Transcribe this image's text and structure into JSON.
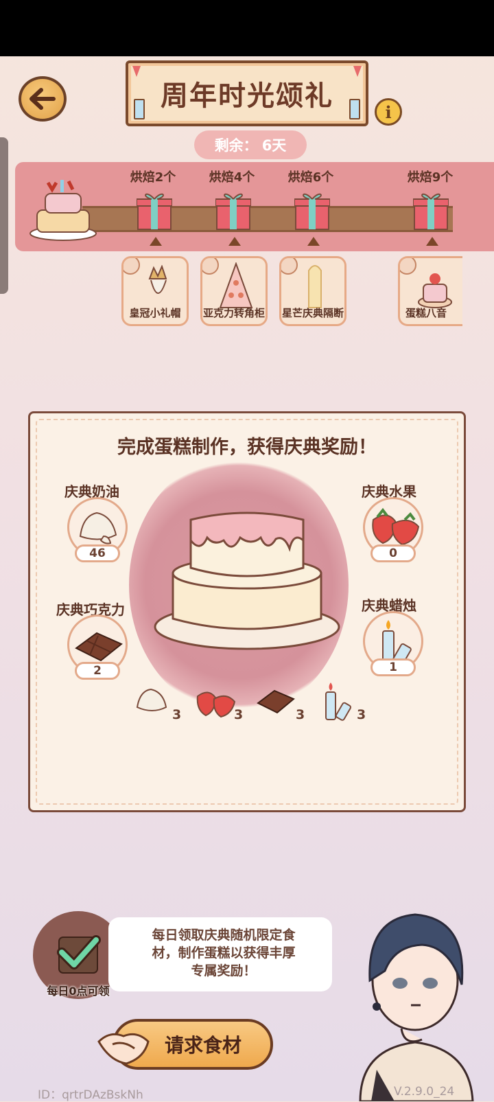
{
  "event": {
    "title": "周年时光颂礼",
    "remaining_label": "剩余：",
    "remaining_value": "6天"
  },
  "milestones": [
    {
      "label": "烘焙2个",
      "reward": "皇冠小礼帽"
    },
    {
      "label": "烘焙4个",
      "reward": "亚克力转角柜"
    },
    {
      "label": "烘焙6个",
      "reward": "星芒庆典隔断"
    },
    {
      "label": "烘焙9个",
      "reward": "蛋糕八音"
    }
  ],
  "panel": {
    "title": "完成蛋糕制作，获得庆典奖励！",
    "ingredients": [
      {
        "name": "庆典奶油",
        "count": "46"
      },
      {
        "name": "庆典水果",
        "count": "0"
      },
      {
        "name": "庆典巧克力",
        "count": "2"
      },
      {
        "name": "庆典蜡烛",
        "count": "1"
      }
    ],
    "requirements": [
      "3",
      "3",
      "3",
      "3"
    ]
  },
  "daily": {
    "label": "每日0点可领",
    "message_line1": "每日领取庆典随机限定食",
    "message_line2": "材，制作蛋糕以获得丰厚",
    "message_line3": "专属奖励！"
  },
  "actions": {
    "request_label": "请求食材"
  },
  "footer": {
    "id": "ID：qrtrDAzBskNh",
    "version": "V.2.9.0_24"
  },
  "colors": {
    "band": "#e49698",
    "panel_border": "#7a4a3a",
    "button": "#efa94d"
  }
}
